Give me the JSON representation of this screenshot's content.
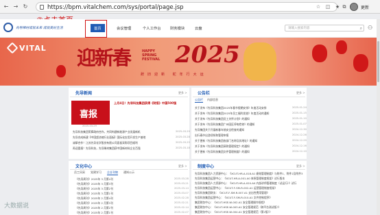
{
  "browser": {
    "url": "https://bpm.vitalchem.com/sys/portal/page.jsp",
    "account_label": "更新"
  },
  "annotation": "②点击首页",
  "header": {
    "slogan": "先导稀材成就未来  成就美好生活",
    "nav": [
      "首页",
      "会议管理",
      "个人工作台",
      "财务模块",
      "云盘"
    ],
    "active_nav": "首页",
    "search_placeholder": "请输入搜索内容"
  },
  "banner": {
    "brand": "VITAL",
    "greeting": "迎新春",
    "happy": "HAPPY",
    "spring": "SPRING",
    "festival": "FESTIVAL",
    "year": "2025",
    "subtitle": "辞旧迎新 蛇年行大运"
  },
  "news": {
    "title": "先导新闻",
    "more": "更多 >",
    "headline": "上月4日！先导科技集团获得《财报》中国500强",
    "image_text": "喜报",
    "image_date": "2025-03-29",
    "items": [
      {
        "text": "先导科技集团荣膺政府合作，共同构建新能源产业发展新机",
        "date": "2025-03-29"
      },
      {
        "text": "先导合成新建【中国超浓缩行业面板】国际化应用开发生产基地",
        "date": "2025-03-28"
      },
      {
        "text": "诚挚合作！江苏先导化学股份有限公司面板采购项目顺利",
        "date": "2025-03-25"
      },
      {
        "text": "再迎喜报！先导科技，先导稀材集团获中国新材料企业百强",
        "date": "2025-03-18"
      }
    ]
  },
  "notice": {
    "title": "公告栏",
    "more": "更多 >",
    "tabs": [
      "公告栏",
      "内部信息"
    ],
    "items": [
      {
        "text": "关于发布《先导科技集团2025年春节假期安排》年度活动安排",
        "date": "2025-01-24"
      },
      {
        "text": "关于发布《先导科技集团2025年员工福利发放》年度活动的通知",
        "date": "2025-01-15"
      },
      {
        "text": "关于发布《先导科技集团员工关怀计划》的通知",
        "date": "2025-01-10"
      },
      {
        "text": "关于发布《先导科技集团广州园区停电检修》的通知",
        "date": "2025-01-07"
      },
      {
        "text": "先导集团关于开展新春年前安全检查的通知",
        "date": "2024-12-30"
      },
      {
        "text": "出行春节出游须知和管理申报",
        "date": "2024-12-26"
      },
      {
        "text": "关于更新《先导科技集团各部门名称及其地址》的通知",
        "date": "2024-12-20"
      },
      {
        "text": "关于发布《先导科技集团采购管理规定》的通知",
        "date": "2024-12-16"
      },
      {
        "text": "关于更新《先导科技集团文件管理制度》的通知",
        "date": "2024-12-10"
      }
    ]
  },
  "culture": {
    "title": "文化中心",
    "more": "更多 >",
    "tabs": [
      "员工风采",
      "党建学习",
      "企业刊物",
      "通知公示"
    ],
    "active_tab": "企业刊物",
    "items": [
      {
        "text": "《先导周刊》2025年 3 月第4刊",
        "date": "2025-03-28"
      },
      {
        "text": "《先导周刊》2025年 3 月第3刊",
        "date": "2025-03-21"
      },
      {
        "text": "《先导周刊》2025年 3 月第2刊",
        "date": "2025-03-14"
      },
      {
        "text": "《先导周刊》2025年 3 月第1刊",
        "date": "2025-03-07"
      },
      {
        "text": "《先导周刊》2025年 2 月第4刊",
        "date": "2025-02-28"
      },
      {
        "text": "《先导周刊》2025年 2 月第3刊",
        "date": "2025-02-21"
      },
      {
        "text": "《先导周刊》2025年 2 月第2刊",
        "date": "2025-02-14"
      },
      {
        "text": "《先导周刊》2025年 2 月第1刊",
        "date": "2025-02-07"
      }
    ]
  },
  "system": {
    "title": "制度中心",
    "more": "更多 >",
    "items": [
      "先导科技集团人力资源中心：《XCUT-HR-A-018.A1 绩效管理制度》与附件1、附件2及附件3",
      "先导科技集团运营中心：《XCUT-HR-A-001.A0 体系管理制度框架》试行版本",
      "先导科技集团人力资源中心：《XCUT-HR-A-020.A0 内部讲师管理制度（试运行）》试行",
      "先导科技集团运营中心：《XCUT-F-SM-R-002.A1 运营管理制度框架》",
      "先导科技集团财务：《XCUT-F-SM-R-007.A1 支出性费用管理》",
      "先导科技集团运营中心：《XCUT-F-SM-R-010.A1 文件控制程序》",
      "集团财务中心：《XCUT-HSE-W-002.A1 安全管理操作规程》",
      "集团财务中心：《XCUT-HSE-W-003.A1 安全管理规范（跨平台测试版）》",
      "集团财务中心：《XCUT-HSE-W-004.A1 安全管理规范（第2版）》"
    ]
  },
  "watermark": "大数据说"
}
